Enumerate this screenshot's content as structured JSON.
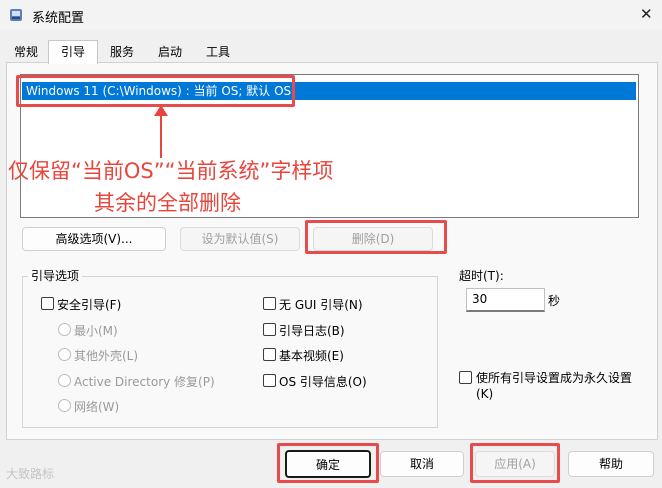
{
  "window": {
    "title": "系统配置",
    "close_glyph": "✕"
  },
  "tabs": [
    "常规",
    "引导",
    "服务",
    "启动",
    "工具"
  ],
  "boot_list": {
    "selected_entry": "Windows 11 (C:\\Windows) : 当前 OS; 默认 OS"
  },
  "annotation": {
    "arrow_color": "#e8453c",
    "line1": "仅保留“当前OS”“当前系统”字样项",
    "line2": "其余的全部删除"
  },
  "boot_buttons": {
    "advanced": "高级选项(V)...",
    "set_default": "设为默认值(S)",
    "delete": "删除(D)"
  },
  "boot_options": {
    "title": "引导选项",
    "safe_boot": "安全引导(F)",
    "minimal": "最小(M)",
    "alternate_shell": "其他外壳(L)",
    "active_directory": "Active Directory 修复(P)",
    "network": "网络(W)",
    "no_gui": "无 GUI 引导(N)",
    "boot_log": "引导日志(B)",
    "base_video": "基本视频(E)",
    "os_boot_info": "OS 引导信息(O)"
  },
  "timeout": {
    "label": "超时(T):",
    "value": "30",
    "unit": "秒"
  },
  "permanent": {
    "line1": "使所有引导设置成为永久设置",
    "line2": "(K)"
  },
  "footer": {
    "ok": "确定",
    "cancel": "取消",
    "apply": "应用(A)",
    "help": "帮助"
  },
  "watermark": "大致路标",
  "colors": {
    "selection": "#0078d7",
    "highlight_box": "#e84b4b"
  }
}
